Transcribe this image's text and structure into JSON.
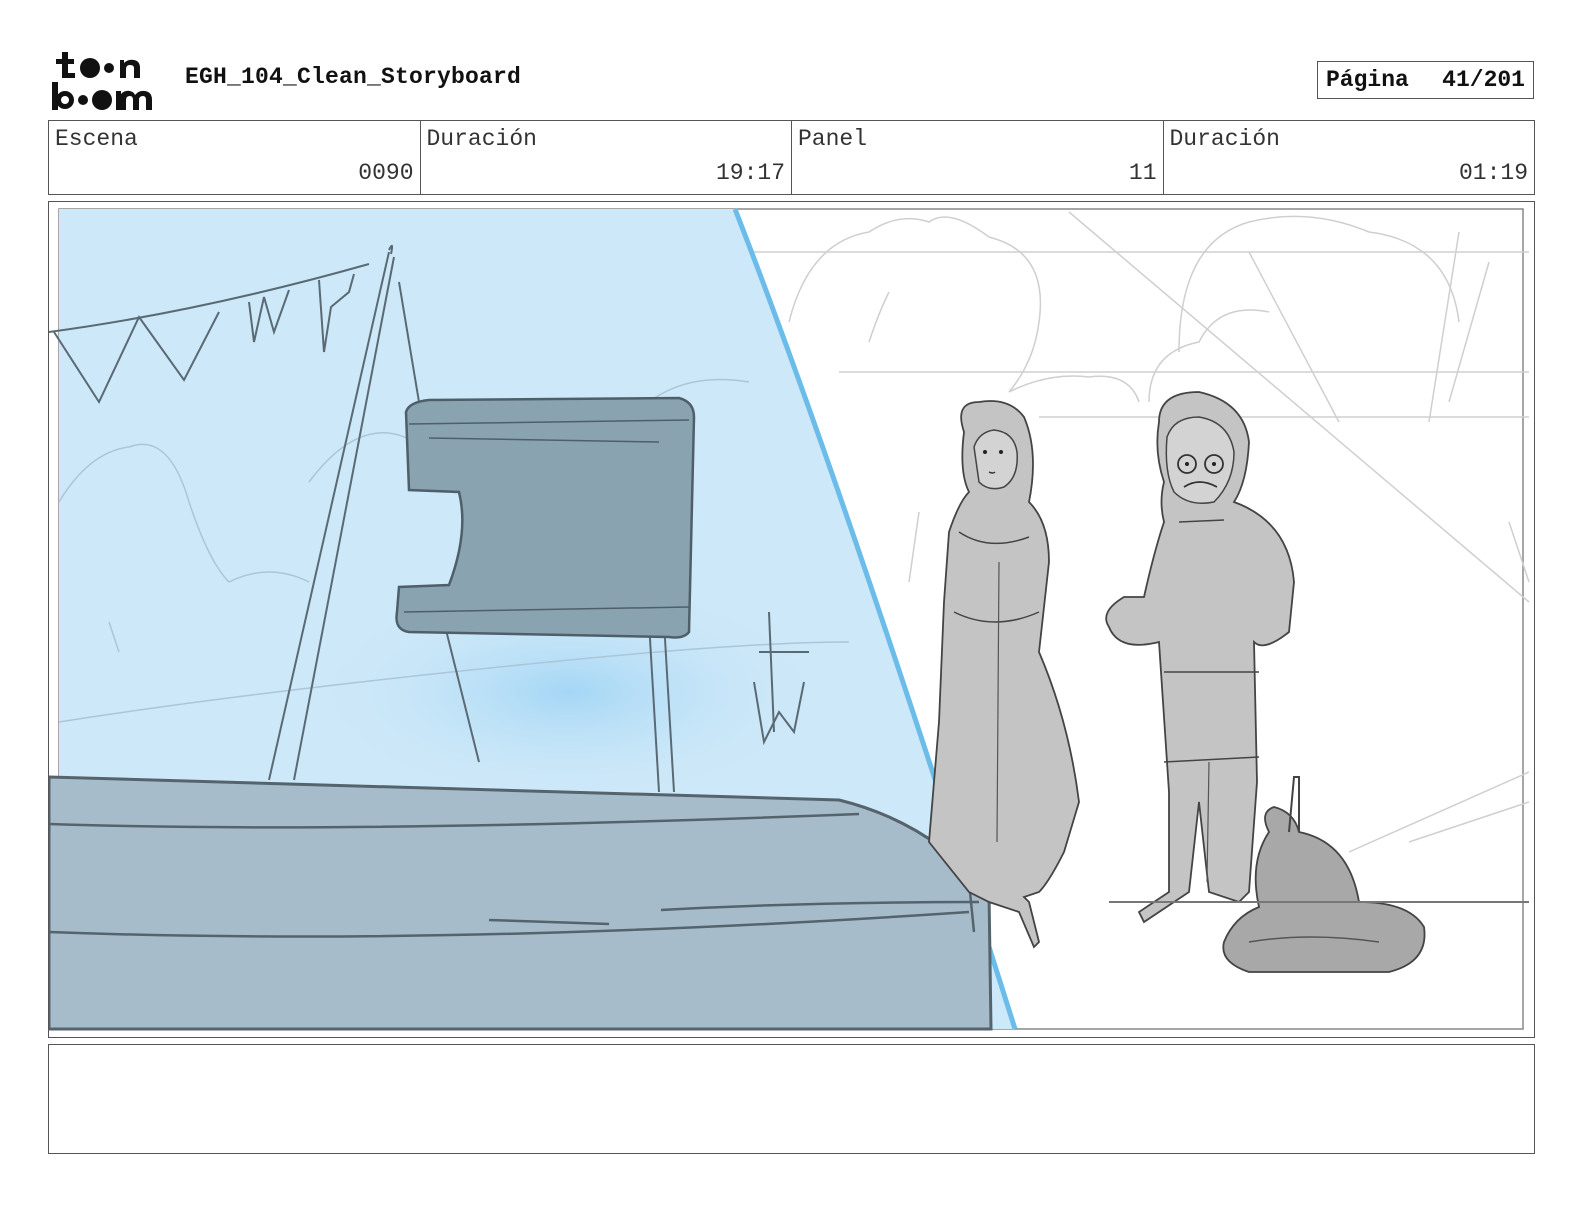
{
  "header": {
    "logo_text": "toon boom",
    "document_title": "EGH_104_Clean_Storyboard",
    "page_label": "Página",
    "page_number": "41/201"
  },
  "info": {
    "scene_label": "Escena",
    "scene_value": "0090",
    "scene_duration_label": "Duración",
    "scene_duration_value": "19:17",
    "panel_label": "Panel",
    "panel_value": "11",
    "panel_duration_label": "Duración",
    "panel_duration_value": "01:19"
  },
  "notes": {
    "text": ""
  },
  "colors": {
    "overlay_blue": "#cde8f8",
    "overlay_edge": "#6cbcea",
    "foreground_slate": "#9fb6c4",
    "billboard": "#8aa3b1",
    "character_fill": "#c4c4c4",
    "sketch_line": "#555555"
  }
}
